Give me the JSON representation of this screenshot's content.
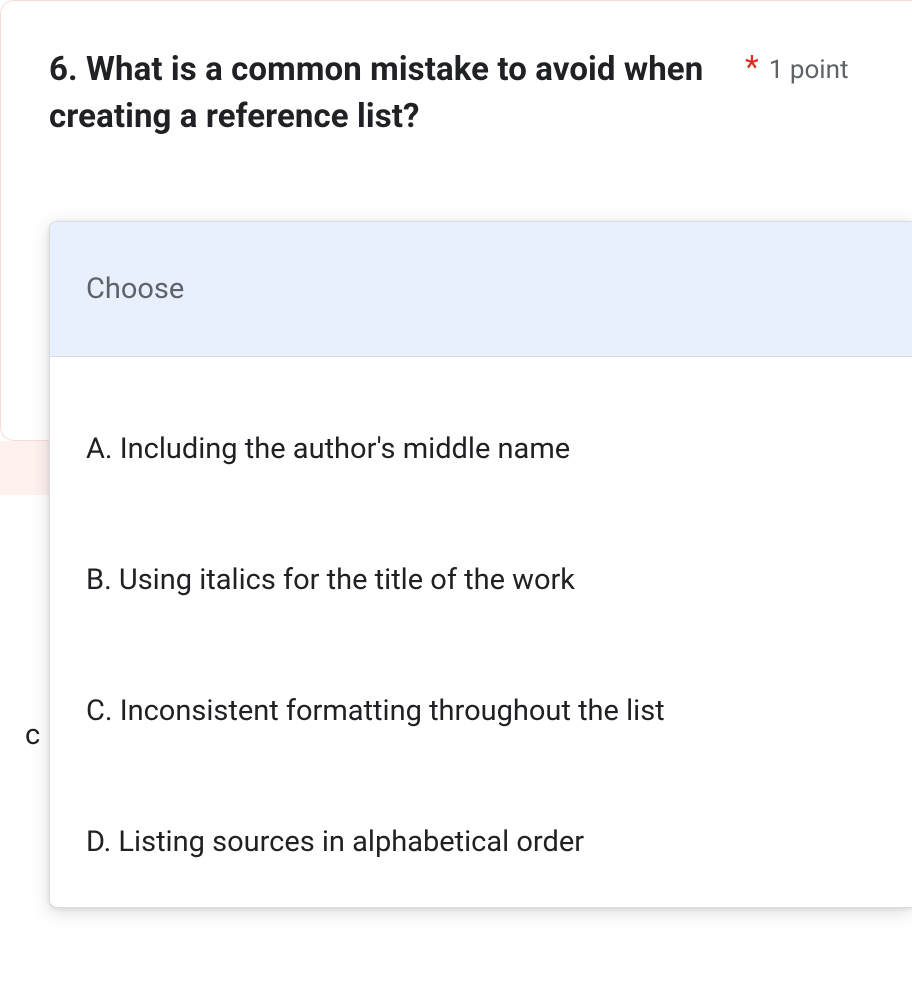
{
  "question": {
    "number_and_text": "6. What is a common mistake to avoid when creating a reference list?",
    "required_marker": "*",
    "points_label": "1 point"
  },
  "dropdown": {
    "placeholder": "Choose",
    "options": [
      "A. Including the author's middle name",
      "B. Using italics for the title of the work",
      "C. Inconsistent formatting throughout the list",
      "D. Listing sources in alphabetical order"
    ]
  }
}
